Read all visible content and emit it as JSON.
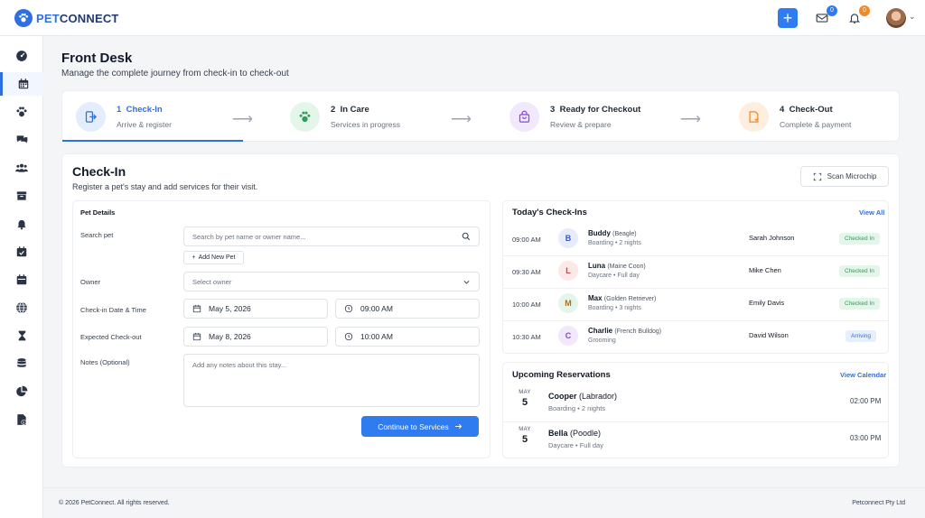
{
  "app": {
    "brand_pet": "PET",
    "brand_connect": "CONNECT"
  },
  "topbar": {
    "plus_label": "+",
    "messages_count": "0",
    "notifications_count": "0"
  },
  "colors": {
    "primary": "#2f7bf0",
    "brand": "#2f6fe0",
    "green": "#2e9e5b",
    "purple": "#8b47d6",
    "orange": "#f08a24"
  },
  "sidebar": {
    "items": [
      "dashboard-icon",
      "calendar-icon",
      "paw-icon",
      "chat-icon",
      "users-icon",
      "store-icon",
      "bell-icon",
      "calendar-check-icon",
      "calendar-icon",
      "globe-icon",
      "hourglass-icon",
      "database-icon",
      "pie-chart-icon",
      "invoice-icon"
    ]
  },
  "page": {
    "title": "Front Desk",
    "subtitle": "Manage the complete journey from check-in to check-out"
  },
  "steps": [
    {
      "num": "1",
      "title": "Check-In",
      "sub": "Arrive & register"
    },
    {
      "num": "2",
      "title": "In Care",
      "sub": "Services in progress"
    },
    {
      "num": "3",
      "title": "Ready for Checkout",
      "sub": "Review & prepare"
    },
    {
      "num": "4",
      "title": "Check-Out",
      "sub": "Complete & payment"
    }
  ],
  "checkin": {
    "title": "Check-In",
    "subtitle": "Register a pet's stay and add services for their visit.",
    "scan_label": "Scan Microchip",
    "form": {
      "section_title": "Pet Details",
      "search_label": "Search pet",
      "search_placeholder": "Search by pet name or owner name...",
      "add_pet_label": "Add New Pet",
      "owner_label": "Owner",
      "owner_placeholder": "Select owner",
      "checkin_label": "Check-in Date & Time",
      "checkin_date": "May 5, 2026",
      "checkin_time": "09:00 AM",
      "checkout_label": "Expected Check-out",
      "checkout_date": "May 8, 2026",
      "checkout_time": "10:00 AM",
      "notes_label": "Notes (Optional)",
      "notes_placeholder": "Add any notes about this stay...",
      "continue_label": "Continue to Services"
    }
  },
  "todays": {
    "title": "Today's Check-Ins",
    "view_all": "View All",
    "rows": [
      {
        "time": "09:00 AM",
        "initial": "B",
        "name": "Buddy",
        "breed": "(Beagle)",
        "service": "Boarding • 2 nights",
        "owner": "Sarah Johnson",
        "status": "Checked In"
      },
      {
        "time": "09:30 AM",
        "initial": "L",
        "name": "Luna",
        "breed": "(Maine Coon)",
        "service": "Daycare • Full day",
        "owner": "Mike Chen",
        "status": "Checked In"
      },
      {
        "time": "10:00 AM",
        "initial": "M",
        "name": "Max",
        "breed": "(Golden Retriever)",
        "service": "Boarding • 3 nights",
        "owner": "Emily Davis",
        "status": "Checked In"
      },
      {
        "time": "10:30 AM",
        "initial": "C",
        "name": "Charlie",
        "breed": "(French Bulldog)",
        "service": "Grooming",
        "owner": "David Wilson",
        "status": "Arriving"
      }
    ]
  },
  "upcoming": {
    "title": "Upcoming Reservations",
    "view_calendar": "View Calendar",
    "rows": [
      {
        "month": "MAY",
        "day": "5",
        "name": "Cooper",
        "breed": "(Labrador)",
        "service": "Boarding • 2 nights",
        "time": "02:00 PM"
      },
      {
        "month": "MAY",
        "day": "5",
        "name": "Bella",
        "breed": "(Poodle)",
        "service": "Daycare • Full day",
        "time": "03:00 PM"
      }
    ]
  },
  "footer": {
    "copyright": "© 2026 PetConnect. All rights reserved.",
    "company": "Petconnect Pty Ltd"
  }
}
